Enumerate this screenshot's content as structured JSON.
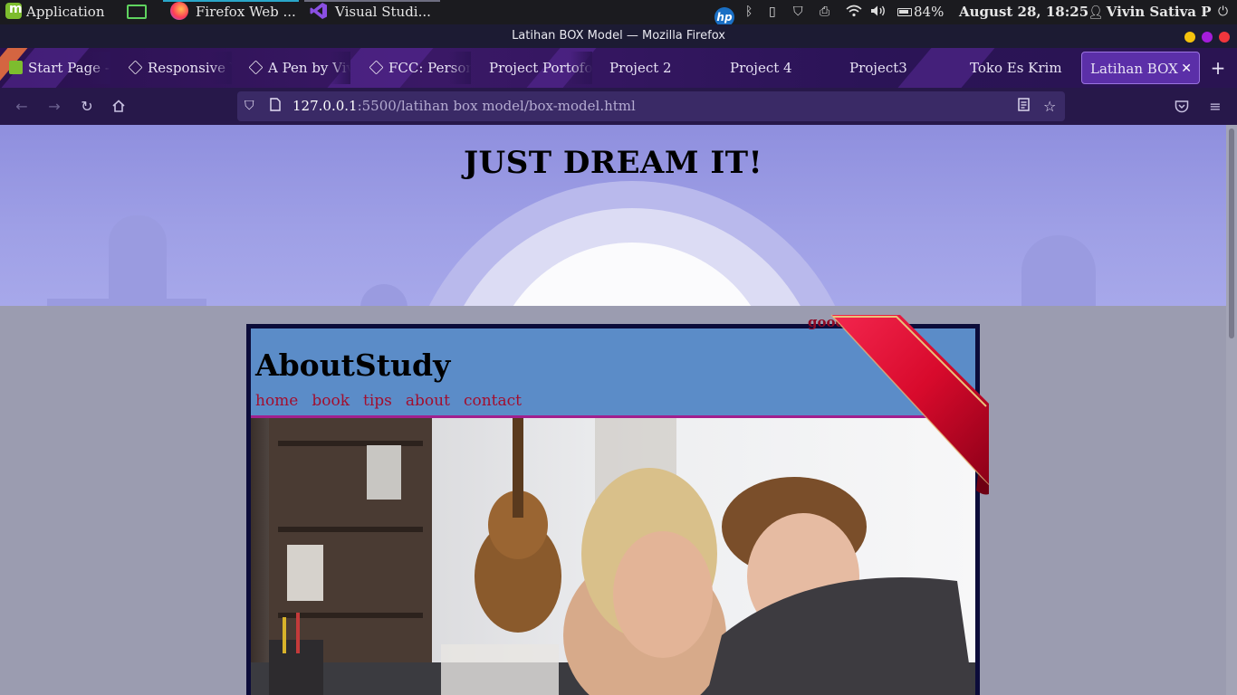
{
  "panel": {
    "menu_label": "Application",
    "tasks": [
      {
        "label": "Firefox Web ...",
        "icon": "firefox-icon"
      },
      {
        "label": "Visual Studi...",
        "icon": "vscode-icon"
      }
    ],
    "battery": "84%",
    "datetime": "August 28, 18:25",
    "user": "Vivin Sativa P",
    "colors": {
      "firefox_task_underline": "#2aa6c9",
      "vscode_task_underline": "#6d6d80"
    }
  },
  "window": {
    "title": "Latihan BOX Model — Mozilla Firefox",
    "controls": {
      "minimize": "#f4c20d",
      "maximize": "#a41ddb",
      "close": "#f0363d"
    }
  },
  "tabs": [
    {
      "label": "Start Page -",
      "icon": "mint-favicon"
    },
    {
      "label": "Responsive W",
      "icon": "codepen-favicon"
    },
    {
      "label": "A Pen by Viv",
      "icon": "codepen-favicon"
    },
    {
      "label": "FCC: Person",
      "icon": "codepen-favicon"
    },
    {
      "label": "Project Portofol",
      "icon": ""
    },
    {
      "label": "Project 2",
      "icon": ""
    },
    {
      "label": "Project 4",
      "icon": ""
    },
    {
      "label": "Project3",
      "icon": ""
    },
    {
      "label": "Toko Es Krim",
      "icon": ""
    },
    {
      "label": "Latihan BOX",
      "icon": "",
      "active": true
    }
  ],
  "nav": {
    "url_host": "127.0.0.1",
    "url_rest": ":5500/latihan box model/box-model.html"
  },
  "page": {
    "hero_title": "JUST DREAM IT!",
    "brand": "AboutStudy",
    "menu": [
      "home",
      "book",
      "tips",
      "about",
      "contact"
    ],
    "ribbon_text": "good",
    "colors": {
      "hero_bg": "#8f8fde",
      "page_bg": "#9b9cb0",
      "card_border": "#0c0c3a",
      "header_bg": "#5b8cc8",
      "header_rule": "#a21f8e",
      "menu_link": "#a20e2e",
      "ribbon": "#d8082c"
    }
  }
}
